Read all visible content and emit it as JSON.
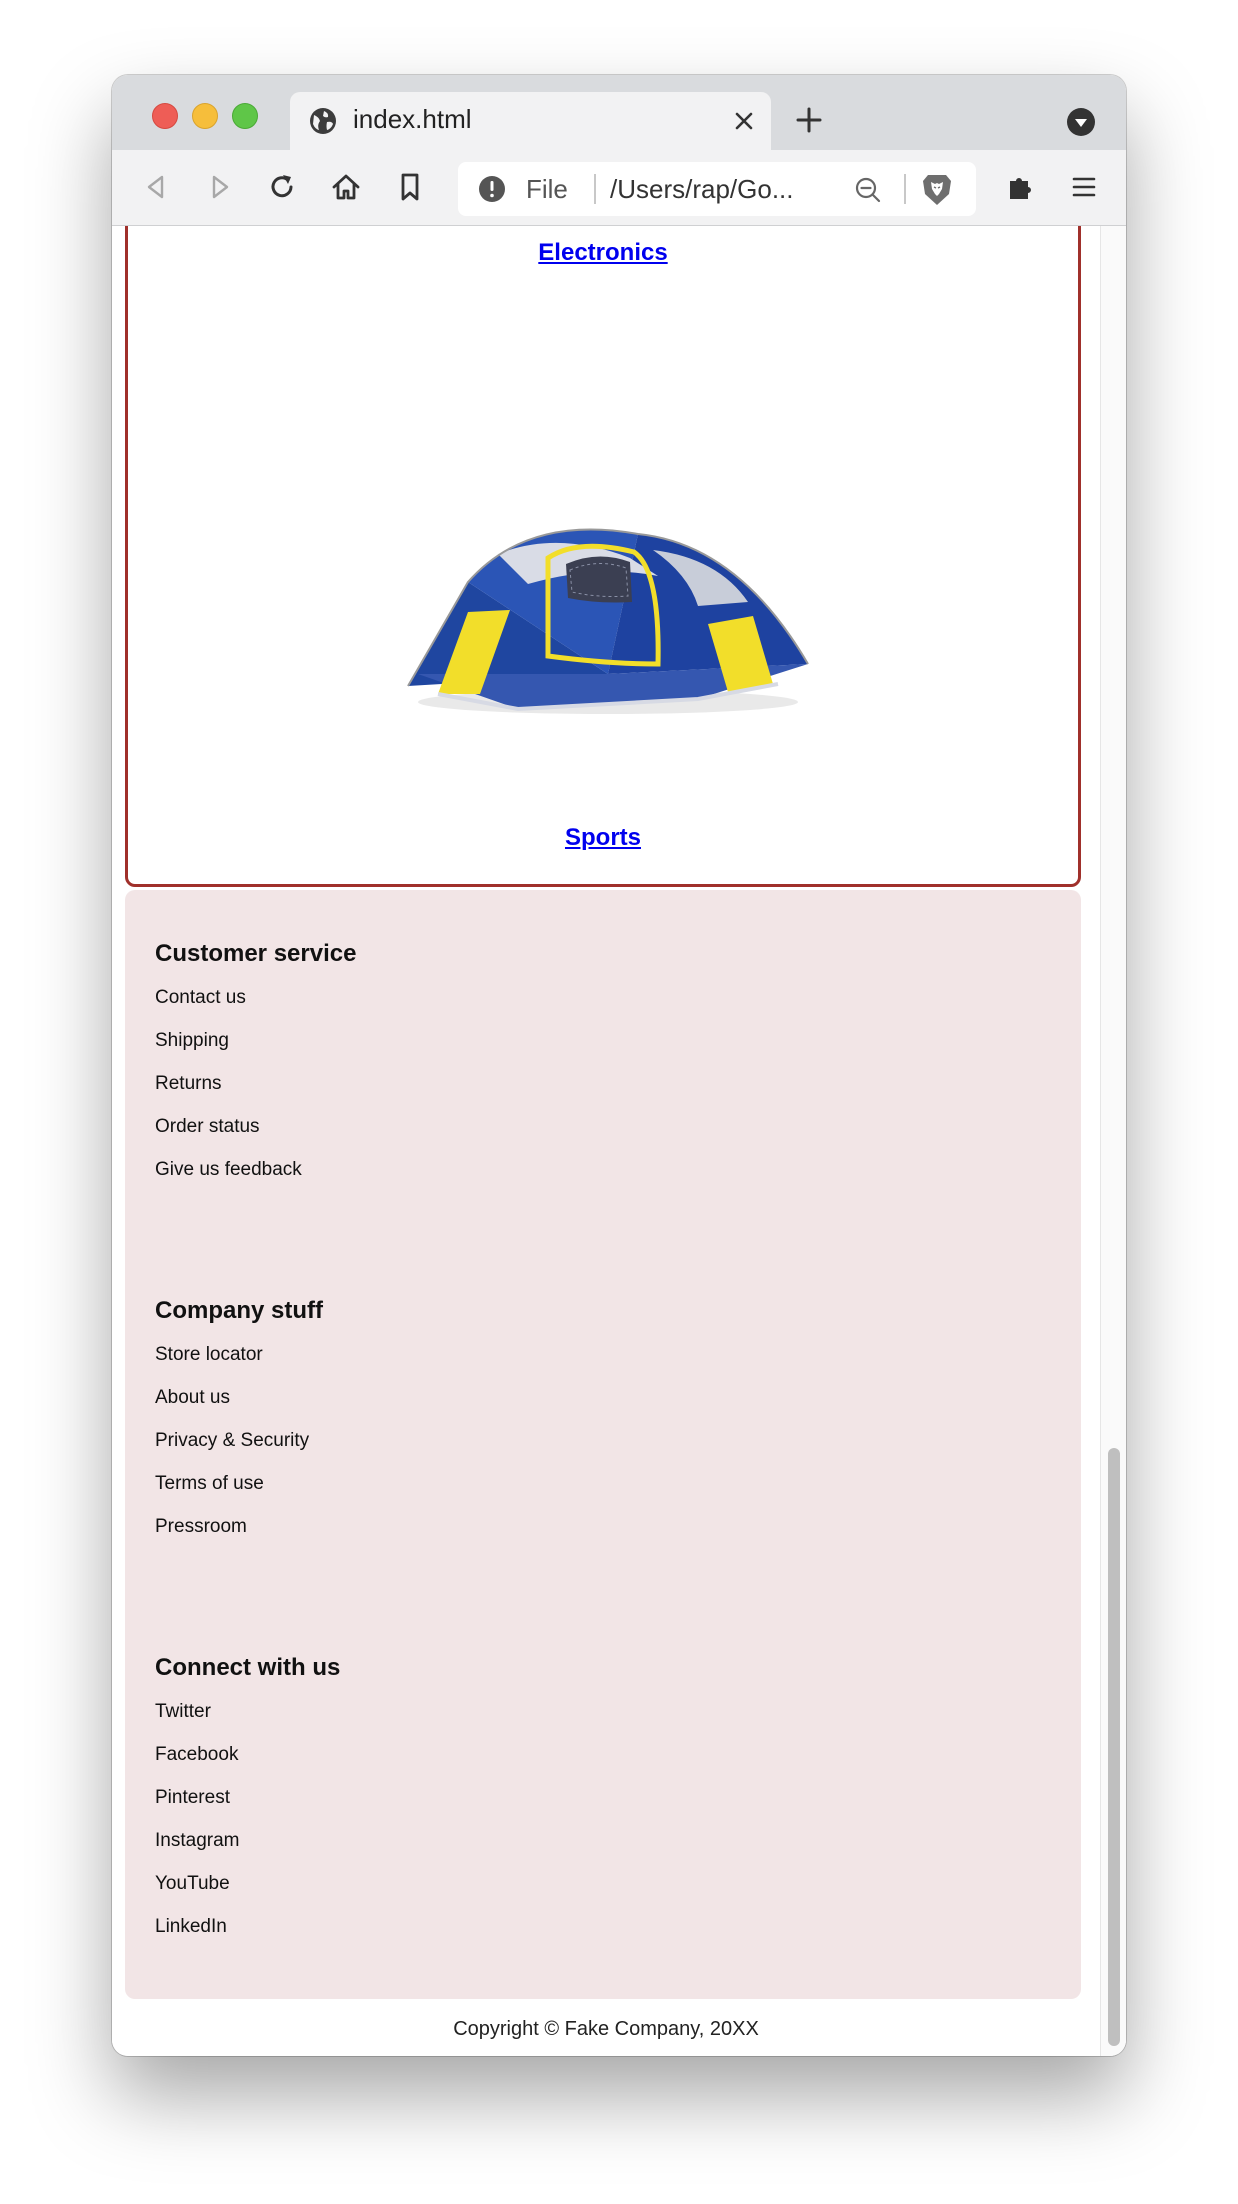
{
  "browser": {
    "tab_title": "index.html",
    "url_scheme": "File",
    "url_text": "/Users/rap/Go..."
  },
  "icons": {
    "window_controls": [
      "close-light",
      "minimize-light",
      "zoom-light"
    ],
    "tab": [
      "globe-icon",
      "close-icon"
    ],
    "toolbar": [
      "back-icon",
      "forward-icon",
      "reload-icon",
      "home-icon",
      "bookmark-icon",
      "info-icon",
      "zoom-out-icon",
      "brave-shield-icon",
      "extensions-icon",
      "menu-icon"
    ],
    "tab_list": "dropdown-icon",
    "new_tab": "plus-icon"
  },
  "content": {
    "category_top": "Electronics",
    "category_bottom": "Sports",
    "image": "tent"
  },
  "footer": {
    "sections": [
      {
        "title": "Customer service",
        "links": [
          "Contact us",
          "Shipping",
          "Returns",
          "Order status",
          "Give us feedback"
        ]
      },
      {
        "title": "Company stuff",
        "links": [
          "Store locator",
          "About us",
          "Privacy & Security",
          "Terms of use",
          "Pressroom"
        ]
      },
      {
        "title": "Connect with us",
        "links": [
          "Twitter",
          "Facebook",
          "Pinterest",
          "Instagram",
          "YouTube",
          "LinkedIn"
        ]
      }
    ],
    "copyright": "Copyright © Fake Company, 20XX"
  },
  "colors": {
    "link": "#0000ee",
    "card_border": "#a0302b",
    "footer_background": "#f2e5e6"
  }
}
